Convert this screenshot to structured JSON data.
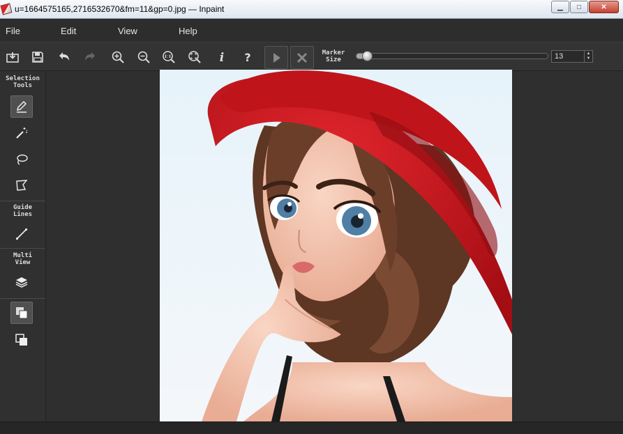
{
  "window": {
    "title": "u=1664575165,2716532670&fm=11&gp=0.jpg — Inpaint",
    "controls": {
      "minimize": "▁",
      "maximize": "□",
      "close": "✕"
    }
  },
  "menu": [
    {
      "id": "file",
      "label": "File"
    },
    {
      "id": "edit",
      "label": "Edit"
    },
    {
      "id": "view",
      "label": "View"
    },
    {
      "id": "help",
      "label": "Help"
    }
  ],
  "toolbar": {
    "buttons": [
      "open-icon",
      "save-icon",
      "undo-icon",
      "redo-icon",
      "zoom-in-icon",
      "zoom-out-icon",
      "zoom-actual-icon",
      "zoom-fit-icon",
      "info-icon",
      "help-icon",
      "run-icon",
      "cancel-icon"
    ],
    "marker_size_label_1": "Marker",
    "marker_size_label_2": "Size",
    "marker_size_value": "13",
    "marker_size_fraction": 0.03
  },
  "sidebar": {
    "selection_tools_1": "Selection",
    "selection_tools_2": "Tools",
    "guide_lines_1": "Guide",
    "guide_lines_2": "Lines",
    "multi_view_1": "Multi",
    "multi_view_2": "View"
  },
  "colors": {
    "hat": "#c0141b",
    "hair": "#6b3e2a",
    "skin": "#f3c9b4",
    "eye": "#4f7fa5",
    "background": "#eaf3f8"
  }
}
